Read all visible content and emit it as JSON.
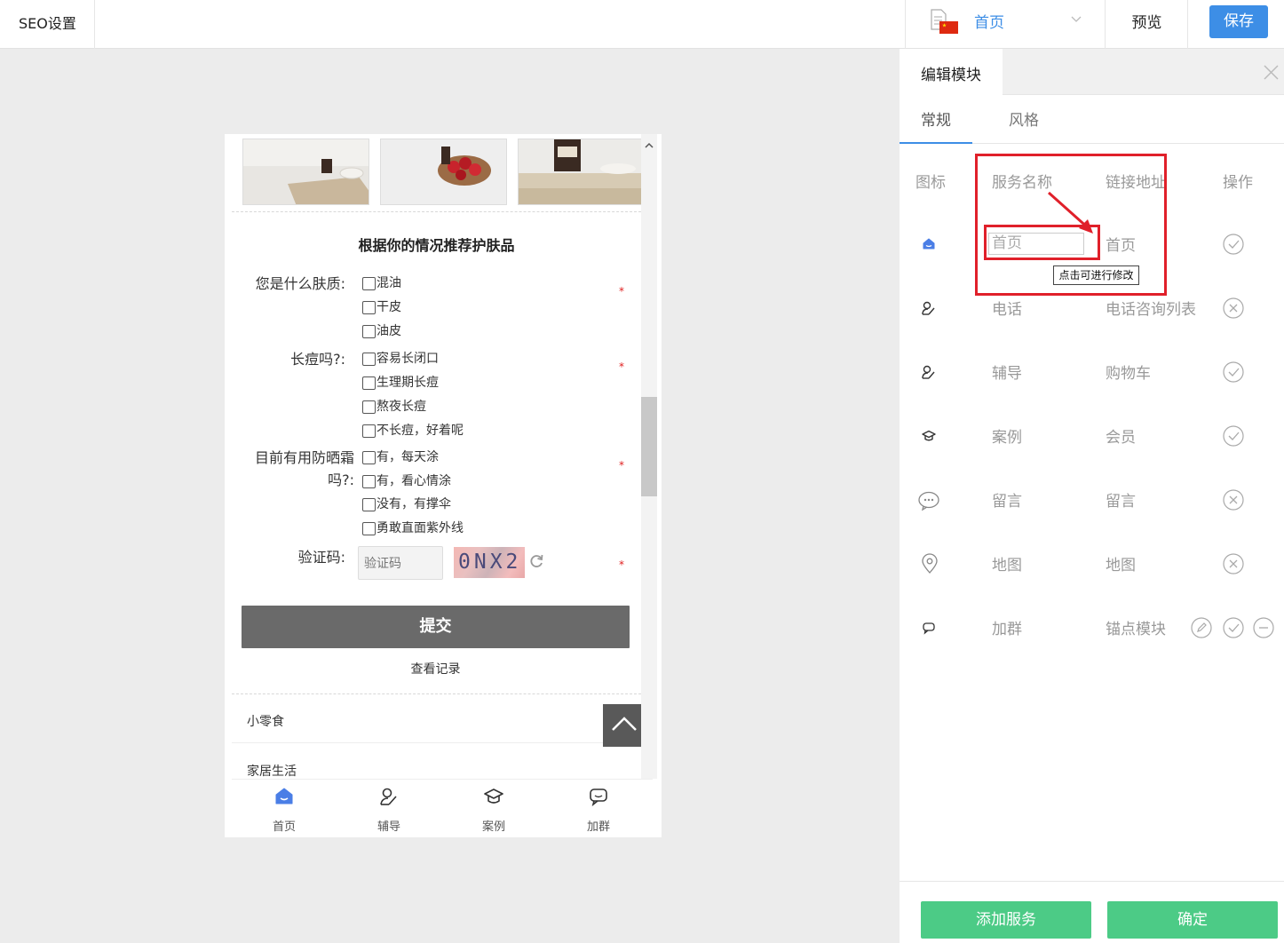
{
  "topbar": {
    "seo_tab": "SEO设置",
    "page_select": "首页",
    "preview": "预览",
    "save": "保存",
    "accent_color": "#3d8ee6"
  },
  "phone": {
    "form_title": "根据你的情况推荐护肤品",
    "questions": [
      {
        "label": "您是什么肤质:",
        "options": [
          "混油",
          "干皮",
          "油皮"
        ]
      },
      {
        "label": "长痘吗?:",
        "options": [
          "容易长闭口",
          "生理期长痘",
          "熬夜长痘",
          "不长痘，好着呢"
        ]
      },
      {
        "label_line1": "目前有用防晒霜",
        "label_line2": "吗?:",
        "options": [
          "有，每天涂",
          "有，看心情涂",
          "没有，有撑伞",
          "勇敢直面紫外线"
        ]
      }
    ],
    "required_mark": "*",
    "captcha_label": "验证码:",
    "captcha_placeholder": "验证码",
    "captcha_code": "0NX2",
    "submit": "提交",
    "view_records": "查看记录",
    "list_items": [
      "小零食",
      "家居生活"
    ],
    "tabbar": [
      {
        "label": "首页",
        "icon": "home-icon"
      },
      {
        "label": "辅导",
        "icon": "user-edit-icon"
      },
      {
        "label": "案例",
        "icon": "graduation-cap-icon"
      },
      {
        "label": "加群",
        "icon": "chat-bubble-icon"
      }
    ]
  },
  "panel": {
    "title": "编辑模块",
    "subtabs": [
      "常规",
      "风格"
    ],
    "headers": {
      "icon": "图标",
      "name": "服务名称",
      "link": "链接地址",
      "action": "操作"
    },
    "rows": [
      {
        "icon": "home-icon",
        "name": "首页",
        "link": "首页",
        "status": "check"
      },
      {
        "icon": "user-edit-icon",
        "name": "电话",
        "link": "电话咨询列表",
        "status": "cross"
      },
      {
        "icon": "user-edit-icon",
        "name": "辅导",
        "link": "购物车",
        "status": "check"
      },
      {
        "icon": "graduation-cap-icon",
        "name": "案例",
        "link": "会员",
        "status": "check"
      },
      {
        "icon": "chat-dots-icon",
        "name": "留言",
        "link": "留言",
        "status": "cross"
      },
      {
        "icon": "map-pin-icon",
        "name": "地图",
        "link": "地图",
        "status": "cross"
      },
      {
        "icon": "chat-bubble-icon",
        "name": "加群",
        "link": "锚点模块",
        "status": "check"
      }
    ],
    "edit_tooltip": "点击可进行修改",
    "add_service": "添加服务",
    "confirm": "确定",
    "highlight_color": "#e0202a",
    "button_color": "#4ccb86"
  }
}
